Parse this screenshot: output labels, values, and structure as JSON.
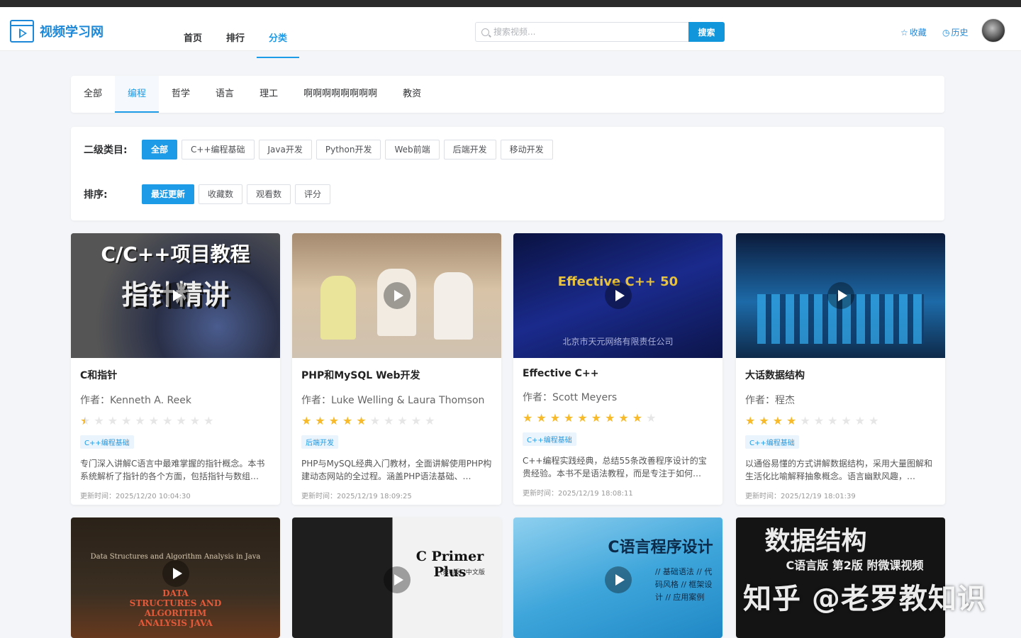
{
  "brand": {
    "name": "视频学习网"
  },
  "nav": [
    "首页",
    "排行",
    "分类"
  ],
  "search": {
    "placeholder": "搜索视频...",
    "button": "搜索"
  },
  "links": {
    "favorites": "收藏",
    "history": "历史"
  },
  "categories": [
    "全部",
    "编程",
    "哲学",
    "语言",
    "理工",
    "啊啊啊啊啊啊啊啊",
    "教资"
  ],
  "filters": {
    "sub_label": "二级类目:",
    "sub_items": [
      "全部",
      "C++编程基础",
      "Java开发",
      "Python开发",
      "Web前端",
      "后端开发",
      "移动开发"
    ],
    "sort_label": "排序:",
    "sort_items": [
      "最近更新",
      "收藏数",
      "观看数",
      "评分"
    ]
  },
  "cards": [
    {
      "title": "C和指针",
      "author": "作者：Kenneth A. Reek",
      "rating": 0.5,
      "tag": "C++编程基础",
      "desc": "专门深入讲解C语言中最难掌握的指针概念。本书系统解析了指针的各个方面，包括指针与数组…",
      "updated": "更新时间：2025/12/20 10:04:30",
      "thumb_title": "C/C++项目教程",
      "thumb_sub": "指针精讲"
    },
    {
      "title": "PHP和MySQL Web开发",
      "author": "作者：Luke Welling & Laura Thomson",
      "rating": 5,
      "tag": "后端开发",
      "desc": "PHP与MySQL经典入门教材，全面讲解使用PHP构建动态网站的全过程。涵盖PHP语法基础、…",
      "updated": "更新时间：2025/12/19 18:09:25"
    },
    {
      "title": "Effective C++",
      "author": "作者：Scott Meyers",
      "rating": 9,
      "tag": "C++编程基础",
      "desc": "C++编程实践经典，总结55条改善程序设计的宝贵经验。本书不是语法教程，而是专注于如何…",
      "updated": "更新时间：2025/12/19 18:08:11",
      "thumb_title": "Effective C++ 50",
      "thumb_sub": "北京市天元网络有限责任公司"
    },
    {
      "title": "大话数据结构",
      "author": "作者：程杰",
      "rating": 4,
      "tag": "C++编程基础",
      "desc": "以通俗易懂的方式讲解数据结构，采用大量图解和生活化比喻解释抽象概念。语言幽默风趣，…",
      "updated": "更新时间：2025/12/19 18:01:39"
    }
  ],
  "bottom_cards": [
    {
      "thumb_title": "Data Structures and Algorithm Analysis in Java",
      "thumb_sub": "DATA STRUCTURES AND ALGORITHM ANALYSIS JAVA"
    },
    {
      "thumb_title": "C Primer Plus",
      "thumb_sub": "（第6版）中文版"
    },
    {
      "thumb_title": "C语言程序设计",
      "thumb_sub": "// 基础语法  // 代码风格  // 框架设计  // 应用案例"
    },
    {
      "thumb_title": "数据结构",
      "thumb_sub": "C语言版 第2版 附微课视频"
    }
  ],
  "watermark": "知乎 @老罗教知识"
}
